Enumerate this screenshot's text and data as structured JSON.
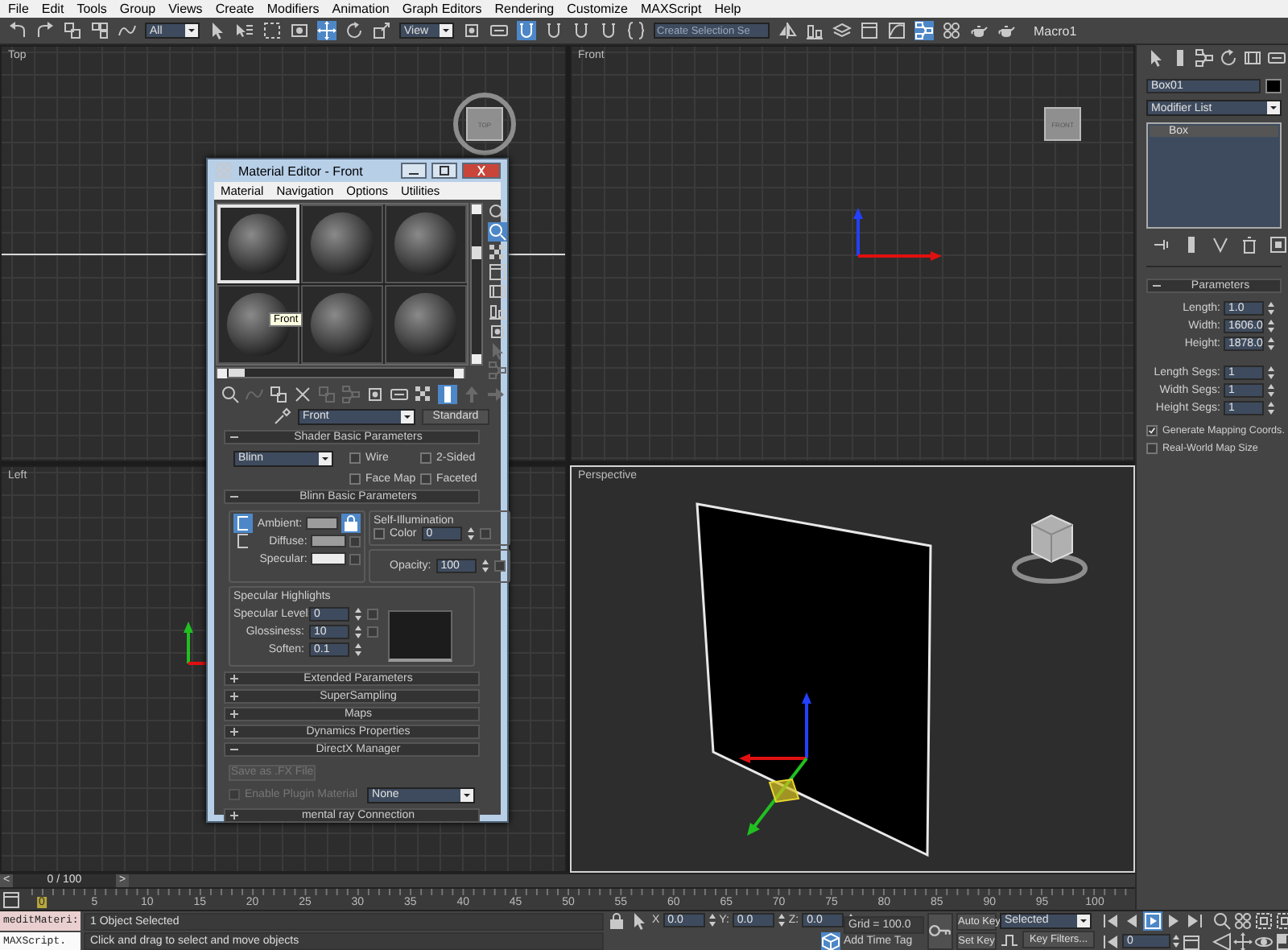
{
  "menu": [
    "File",
    "Edit",
    "Tools",
    "Group",
    "Views",
    "Create",
    "Modifiers",
    "Animation",
    "Graph Editors",
    "Rendering",
    "Customize",
    "MAXScript",
    "Help"
  ],
  "toolbar": [
    {
      "kind": "button",
      "active": false
    },
    {
      "kind": "button",
      "active": false
    },
    {
      "kind": "button",
      "active": false
    },
    {
      "kind": "button",
      "active": false
    },
    {
      "kind": "button",
      "active": false
    },
    {
      "kind": "dropdown",
      "value": "All"
    },
    {
      "kind": "button",
      "active": false
    },
    {
      "kind": "button",
      "active": false
    },
    {
      "kind": "button",
      "active": false
    },
    {
      "kind": "button",
      "active": false
    },
    {
      "kind": "button",
      "active": true
    },
    {
      "kind": "button",
      "active": false
    },
    {
      "kind": "button",
      "active": false
    },
    {
      "kind": "dropdown",
      "value": "View"
    },
    {
      "kind": "button",
      "active": false
    },
    {
      "kind": "button",
      "active": false
    },
    {
      "kind": "button",
      "active": true
    },
    {
      "kind": "button",
      "active": false
    },
    {
      "kind": "button",
      "active": false
    },
    {
      "kind": "button",
      "active": false
    },
    {
      "kind": "button",
      "active": false
    },
    {
      "kind": "field",
      "placeholder": "Create Selection Se"
    },
    {
      "kind": "button",
      "active": false
    },
    {
      "kind": "button",
      "active": false
    },
    {
      "kind": "button",
      "active": false
    },
    {
      "kind": "button",
      "active": false
    },
    {
      "kind": "button",
      "active": false
    },
    {
      "kind": "button",
      "active": true
    },
    {
      "kind": "button",
      "active": false
    },
    {
      "kind": "button",
      "active": false
    },
    {
      "kind": "button",
      "active": false
    },
    {
      "kind": "label",
      "text": "Macro1"
    }
  ],
  "viewports": [
    {
      "label": "Top",
      "active": false,
      "grid": true,
      "cube_label": "TOP"
    },
    {
      "label": "Front",
      "active": false,
      "grid": true,
      "cube_label": "FRONT"
    },
    {
      "label": "Left",
      "active": false,
      "grid": true
    },
    {
      "label": "Perspective",
      "active": true,
      "grid": false
    }
  ],
  "material_editor": {
    "title": "Material Editor - Front",
    "menu": [
      "Material",
      "Navigation",
      "Options",
      "Utilities"
    ],
    "slots": [
      {
        "selected": true
      },
      {
        "selected": false
      },
      {
        "selected": false
      },
      {
        "selected": false
      },
      {
        "selected": false
      },
      {
        "selected": false
      }
    ],
    "tooltip": "Front",
    "side_tools": [
      {
        "active": false,
        "disabled": false
      },
      {
        "active": true,
        "disabled": false
      },
      {
        "active": false,
        "disabled": false
      },
      {
        "active": false,
        "disabled": false
      },
      {
        "active": false,
        "disabled": false
      },
      {
        "active": false,
        "disabled": false
      },
      {
        "active": false,
        "disabled": false
      },
      {
        "active": false,
        "disabled": true
      },
      {
        "active": false,
        "disabled": true
      }
    ],
    "tools": [
      {
        "active": false,
        "disabled": false
      },
      {
        "active": false,
        "disabled": true
      },
      {
        "active": false,
        "disabled": false
      },
      {
        "active": false,
        "disabled": false
      },
      {
        "active": false,
        "disabled": true
      },
      {
        "active": false,
        "disabled": true
      },
      {
        "active": false,
        "disabled": false
      },
      {
        "active": false,
        "disabled": false
      },
      {
        "active": false,
        "disabled": false
      },
      {
        "active": true,
        "disabled": false
      },
      {
        "active": false,
        "disabled": true
      },
      {
        "active": false,
        "disabled": true
      }
    ],
    "material_name": "Front",
    "material_type": "Standard",
    "rollouts": [
      {
        "kind": "shader",
        "title": "Shader Basic Parameters",
        "expanded": true,
        "shader": "Blinn",
        "options": [
          {
            "label": "Wire",
            "checked": false
          },
          {
            "label": "2-Sided",
            "checked": false
          },
          {
            "label": "Face Map",
            "checked": false
          },
          {
            "label": "Faceted",
            "checked": false
          }
        ]
      },
      {
        "kind": "blinn",
        "title": "Blinn Basic Parameters",
        "expanded": true,
        "colors": [
          {
            "label": "Ambient:",
            "color": "#9c9c9c"
          },
          {
            "label": "Diffuse:",
            "color": "#9c9c9c"
          },
          {
            "label": "Specular:",
            "color": "#ececec"
          }
        ],
        "self_illumination": {
          "title": "Self-Illumination",
          "label": "Color",
          "checked": false,
          "value": "0"
        },
        "opacity": {
          "label": "Opacity:",
          "value": "100"
        },
        "highlights": {
          "title": "Specular Highlights",
          "fields": [
            {
              "label": "Specular Level:",
              "value": "0"
            },
            {
              "label": "Glossiness:",
              "value": "10"
            },
            {
              "label": "Soften:",
              "value": "0.1"
            }
          ]
        }
      },
      {
        "kind": "plain",
        "title": "Extended Parameters",
        "expanded": false
      },
      {
        "kind": "plain",
        "title": "SuperSampling",
        "expanded": false
      },
      {
        "kind": "plain",
        "title": "Maps",
        "expanded": false
      },
      {
        "kind": "plain",
        "title": "Dynamics Properties",
        "expanded": false
      },
      {
        "kind": "directx",
        "title": "DirectX Manager",
        "expanded": true,
        "button": "Save as .FX File",
        "button_disabled": true,
        "plugin": {
          "label": "Enable Plugin Material",
          "checked": false,
          "disabled": true
        },
        "plugin_value": "None"
      },
      {
        "kind": "plain",
        "title": "mental ray Connection",
        "expanded": false
      }
    ]
  },
  "command_panel": {
    "object_name": "Box01",
    "modifier_list": "Modifier List",
    "stack": [
      "Box"
    ],
    "rollout": {
      "title": "Parameters",
      "expanded": true,
      "fields": [
        {
          "label": "Length:",
          "value": "1.0"
        },
        {
          "label": "Width:",
          "value": "1606.0"
        },
        {
          "label": "Height:",
          "value": "1878.0"
        }
      ],
      "segments": [
        {
          "label": "Length Segs:",
          "value": "1"
        },
        {
          "label": "Width Segs:",
          "value": "1"
        },
        {
          "label": "Height Segs:",
          "value": "1"
        }
      ],
      "checks": [
        {
          "label": "Generate Mapping Coords.",
          "checked": true
        },
        {
          "label": "Real-World Map Size",
          "checked": false
        }
      ]
    }
  },
  "time_slider": {
    "previous": "<",
    "position": "0 / 100",
    "next": ">"
  },
  "track_bar": {
    "ticks": [
      {
        "label": "0",
        "current": true
      },
      {
        "label": "5",
        "current": false
      },
      {
        "label": "10",
        "current": false
      },
      {
        "label": "15",
        "current": false
      },
      {
        "label": "20",
        "current": false
      },
      {
        "label": "25",
        "current": false
      },
      {
        "label": "30",
        "current": false
      },
      {
        "label": "35",
        "current": false
      },
      {
        "label": "40",
        "current": false
      },
      {
        "label": "45",
        "current": false
      },
      {
        "label": "50",
        "current": false
      },
      {
        "label": "55",
        "current": false
      },
      {
        "label": "60",
        "current": false
      },
      {
        "label": "65",
        "current": false
      },
      {
        "label": "70",
        "current": false
      },
      {
        "label": "75",
        "current": false
      },
      {
        "label": "80",
        "current": false
      },
      {
        "label": "85",
        "current": false
      },
      {
        "label": "90",
        "current": false
      },
      {
        "label": "95",
        "current": false
      },
      {
        "label": "100",
        "current": false
      }
    ]
  },
  "status_bar": {
    "listener": [
      {
        "kind": "input",
        "text": "meditMateri:"
      },
      {
        "kind": "output",
        "text": "MAXScript."
      }
    ],
    "selection": "1 Object Selected",
    "prompt": "Click and drag to select and move objects",
    "coords": [
      {
        "axis": "X",
        "value": "0.0"
      },
      {
        "axis": "Y:",
        "value": "0.0"
      },
      {
        "axis": "Z:",
        "value": "0.0"
      }
    ],
    "grid": "Grid = 100.0",
    "time_tag": "Add Time Tag",
    "auto_key": "Auto Key",
    "key_mode": "Selected",
    "set_key": "Set Key",
    "key_filters": "Key Filters...",
    "frame": "0"
  }
}
